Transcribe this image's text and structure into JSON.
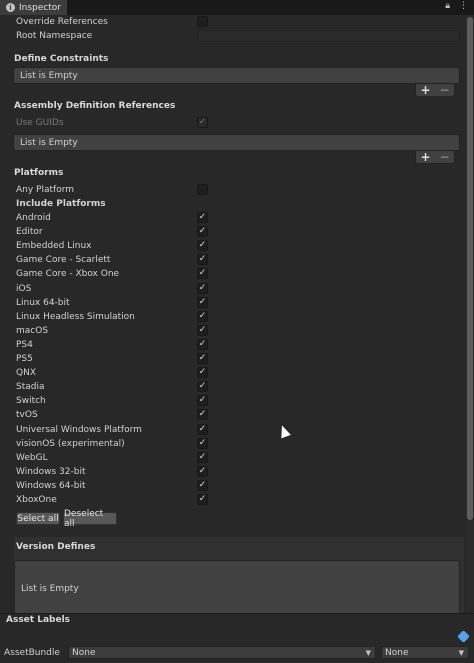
{
  "window": {
    "tab_title": "Inspector",
    "tab_icon": "info-icon",
    "lock_icon": "lock-icon",
    "menu_icon": "kebab-menu-icon"
  },
  "general": {
    "override_references": {
      "label": "Override References",
      "checked": false
    },
    "root_namespace": {
      "label": "Root Namespace",
      "value": ""
    }
  },
  "define_constraints": {
    "header": "Define Constraints",
    "empty_text": "List is Empty",
    "add_label": "+",
    "remove_label": "−"
  },
  "assembly_refs": {
    "header": "Assembly Definition References",
    "use_guids": {
      "label": "Use GUIDs",
      "checked": true,
      "enabled": false
    },
    "empty_text": "List is Empty",
    "add_label": "+",
    "remove_label": "−"
  },
  "platforms": {
    "header": "Platforms",
    "any_platform": {
      "label": "Any Platform",
      "checked": false
    },
    "include_label": "Include Platforms",
    "items": [
      {
        "label": "Android",
        "checked": true
      },
      {
        "label": "Editor",
        "checked": true
      },
      {
        "label": "Embedded Linux",
        "checked": true
      },
      {
        "label": "Game Core - Scarlett",
        "checked": true
      },
      {
        "label": "Game Core - Xbox One",
        "checked": true
      },
      {
        "label": "iOS",
        "checked": true
      },
      {
        "label": "Linux 64-bit",
        "checked": true
      },
      {
        "label": "Linux Headless Simulation",
        "checked": true
      },
      {
        "label": "macOS",
        "checked": true
      },
      {
        "label": "PS4",
        "checked": true
      },
      {
        "label": "PS5",
        "checked": true
      },
      {
        "label": "QNX",
        "checked": true
      },
      {
        "label": "Stadia",
        "checked": true
      },
      {
        "label": "Switch",
        "checked": true
      },
      {
        "label": "tvOS",
        "checked": true
      },
      {
        "label": "Universal Windows Platform",
        "checked": true
      },
      {
        "label": "visionOS (experimental)",
        "checked": true
      },
      {
        "label": "WebGL",
        "checked": true
      },
      {
        "label": "Windows 32-bit",
        "checked": true
      },
      {
        "label": "Windows 64-bit",
        "checked": true
      },
      {
        "label": "XboxOne",
        "checked": true
      }
    ],
    "select_all": "Select all",
    "deselect_all": "Deselect all"
  },
  "version_defines": {
    "header": "Version Defines",
    "empty_text": "List is Empty"
  },
  "asset_labels": {
    "header": "Asset Labels",
    "tag_icon": "tag-icon",
    "assetbundle_label": "AssetBundle",
    "bundle_value": "None",
    "variant_value": "None"
  }
}
